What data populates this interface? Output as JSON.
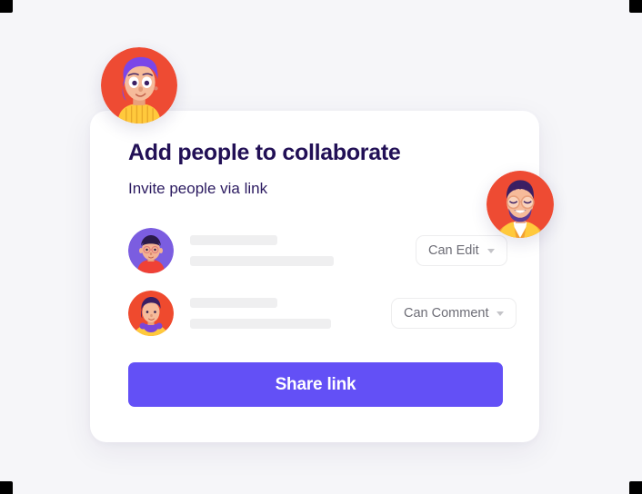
{
  "page": {
    "background_color": "#f6f6f9",
    "corner_marker_color": "#000000"
  },
  "card": {
    "title": "Add people to collaborate",
    "subtitle": "Invite people via link",
    "background_color": "#ffffff",
    "title_color": "#221056"
  },
  "people": [
    {
      "avatar_name": "avatar-person-glasses-red-shirt",
      "name_placeholder": "",
      "detail_placeholder": "",
      "permission": "Can Edit"
    },
    {
      "avatar_name": "avatar-person-purple-hair",
      "name_placeholder": "",
      "detail_placeholder": "",
      "permission": "Can Comment"
    }
  ],
  "share_button": {
    "label": "Share link",
    "color": "#6350f6",
    "text_color": "#ffffff"
  },
  "floating_avatars": [
    {
      "name": "avatar-woman-purple-hair",
      "position": "top-left"
    },
    {
      "name": "avatar-man-glasses-beard",
      "position": "right-middle"
    }
  ],
  "icons": {
    "caret": "chevron-down-icon"
  }
}
